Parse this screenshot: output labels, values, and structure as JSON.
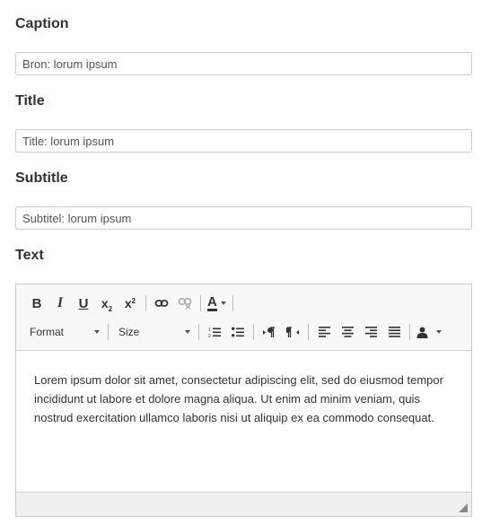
{
  "fields": {
    "caption": {
      "label": "Caption",
      "value": "Bron: lorum ipsum"
    },
    "title": {
      "label": "Title",
      "value": "Title: lorum ipsum"
    },
    "subtitle": {
      "label": "Subtitle",
      "value": "Subtitel: lorum ipsum"
    }
  },
  "editor": {
    "label": "Text",
    "toolbar": {
      "bold": "B",
      "italic": "I",
      "underline": "U",
      "subscript": "x",
      "superscript": "x",
      "text_color": "A",
      "format_label": "Format",
      "size_label": "Size"
    },
    "content": "Lorem ipsum dolor sit amet, consectetur adipiscing elit, sed do eiusmod tempor incididunt ut labore et dolore magna aliqua. Ut enim ad minim veniam, quis nostrud exercitation ullamco laboris nisi ut aliquip ex ea commodo consequat."
  },
  "icons": [
    "bold-icon",
    "italic-icon",
    "underline-icon",
    "subscript-icon",
    "superscript-icon",
    "link-icon",
    "unlink-icon",
    "text-color-icon",
    "numbered-list-icon",
    "bulleted-list-icon",
    "ltr-icon",
    "rtl-icon",
    "align-left-icon",
    "align-center-icon",
    "align-right-icon",
    "justify-icon",
    "person-icon",
    "resize-handle-icon"
  ]
}
